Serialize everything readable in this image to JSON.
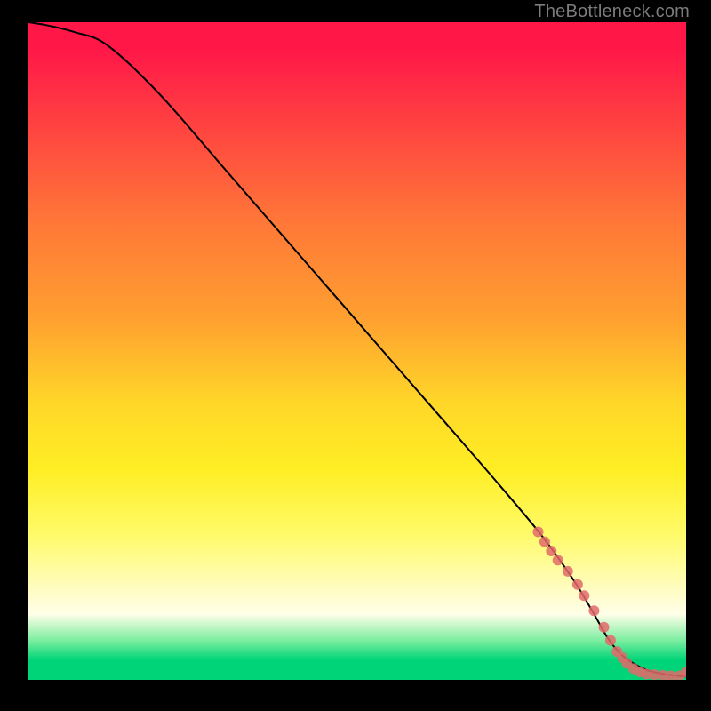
{
  "watermark": "TheBottleneck.com",
  "chart_data": {
    "type": "line",
    "title": "",
    "xlabel": "",
    "ylabel": "",
    "xlim": [
      0,
      100
    ],
    "ylim": [
      0,
      100
    ],
    "grid": false,
    "curve": {
      "x": [
        0,
        3,
        7,
        12,
        20,
        30,
        40,
        50,
        60,
        70,
        78,
        83,
        86,
        88,
        90,
        92,
        94,
        96,
        98,
        100
      ],
      "y": [
        100,
        99.5,
        98.5,
        96.5,
        89,
        77.5,
        66,
        54.5,
        43,
        31.5,
        22,
        15,
        10,
        6.5,
        4,
        2.5,
        1.5,
        1,
        0.7,
        0.5
      ]
    },
    "markers": [
      {
        "x": 77.5,
        "y": 22.5
      },
      {
        "x": 78.5,
        "y": 21
      },
      {
        "x": 79.5,
        "y": 19.6
      },
      {
        "x": 80.5,
        "y": 18.2
      },
      {
        "x": 82,
        "y": 16.5
      },
      {
        "x": 83.5,
        "y": 14.5
      },
      {
        "x": 84.5,
        "y": 12.8
      },
      {
        "x": 86,
        "y": 10.5
      },
      {
        "x": 87.5,
        "y": 8
      },
      {
        "x": 88.5,
        "y": 6
      },
      {
        "x": 89.5,
        "y": 4.3
      },
      {
        "x": 90.3,
        "y": 3.4
      },
      {
        "x": 91,
        "y": 2.5
      },
      {
        "x": 92,
        "y": 1.7
      },
      {
        "x": 93,
        "y": 1.2
      },
      {
        "x": 94,
        "y": 0.9
      },
      {
        "x": 95.2,
        "y": 0.8
      },
      {
        "x": 96.5,
        "y": 0.7
      },
      {
        "x": 97.7,
        "y": 0.6
      },
      {
        "x": 99,
        "y": 0.6
      },
      {
        "x": 100,
        "y": 1.2
      }
    ],
    "marker_color": "#e26a6a",
    "marker_radius": 6,
    "line_color": "#000000",
    "line_width": 2
  }
}
